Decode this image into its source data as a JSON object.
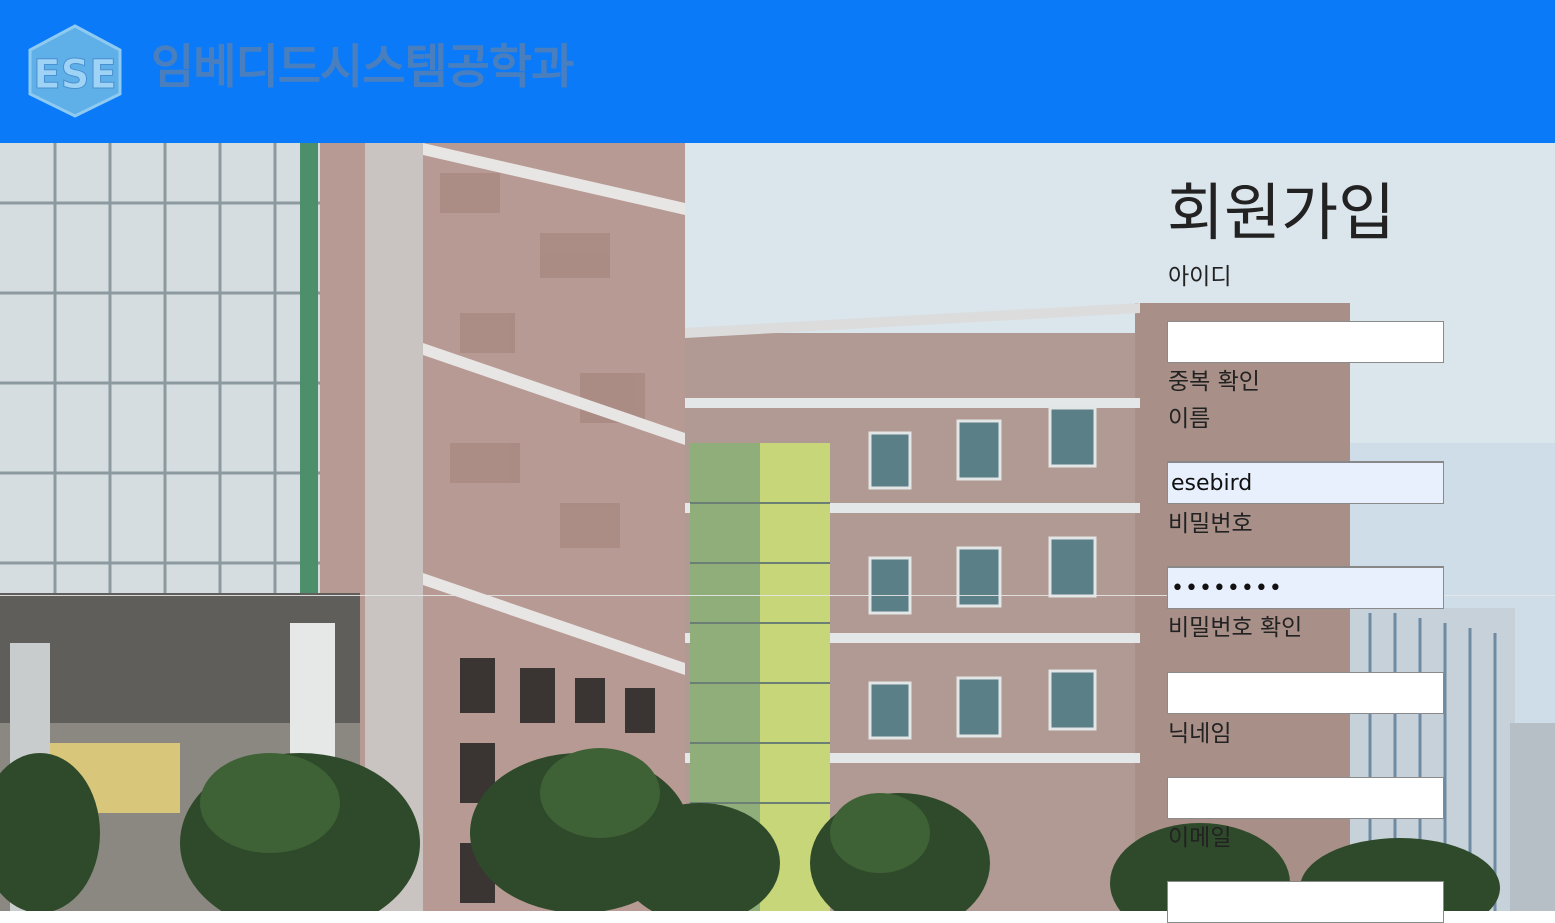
{
  "header": {
    "logo_text": "ESE",
    "department_title": "임베디드시스템공학과",
    "background_color": "#0a7af8"
  },
  "signup": {
    "title": "회원가입",
    "id_label": "아이디",
    "id_value": "",
    "duplicate_check_link": "중복 확인",
    "name_label": "이름",
    "name_value": "esebird",
    "password_label": "비밀번호",
    "password_value": "••••••••",
    "password_confirm_label": "비밀번호 확인",
    "password_confirm_value": "",
    "nickname_label": "닉네임",
    "nickname_value": "",
    "email_label": "이메일",
    "email_value": ""
  }
}
